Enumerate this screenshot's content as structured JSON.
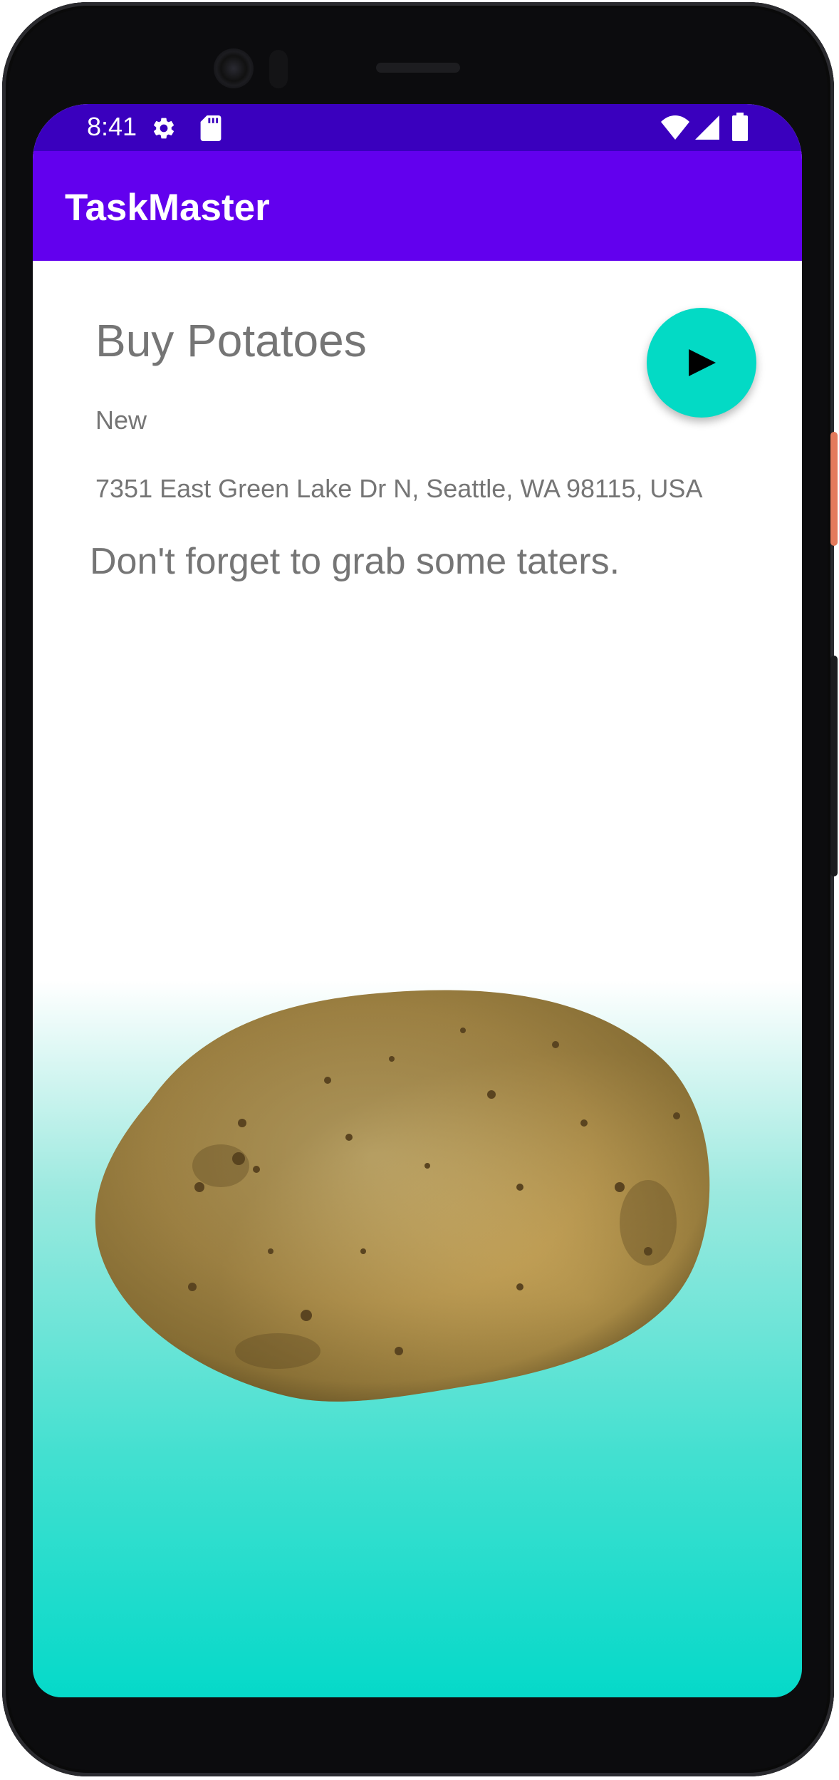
{
  "status_bar": {
    "time": "8:41",
    "left_icons": [
      "gear-icon",
      "sd-card-icon"
    ],
    "right_icons": [
      "wifi-icon",
      "cell-signal-icon",
      "battery-icon"
    ],
    "color": "#3a00be"
  },
  "app_bar": {
    "title": "TaskMaster",
    "color": "#6200ee"
  },
  "task": {
    "title": "Buy Potatoes",
    "state": "New",
    "address": "7351 East Green Lake Dr N, Seattle, WA 98115, USA",
    "body": "Don't forget to grab some taters."
  },
  "fab": {
    "icon": "play-icon",
    "color": "#03dac5"
  },
  "image": {
    "subject": "potato-image"
  },
  "colors": {
    "text_secondary": "#757575",
    "gradient_bottom": "#05d9c9"
  }
}
